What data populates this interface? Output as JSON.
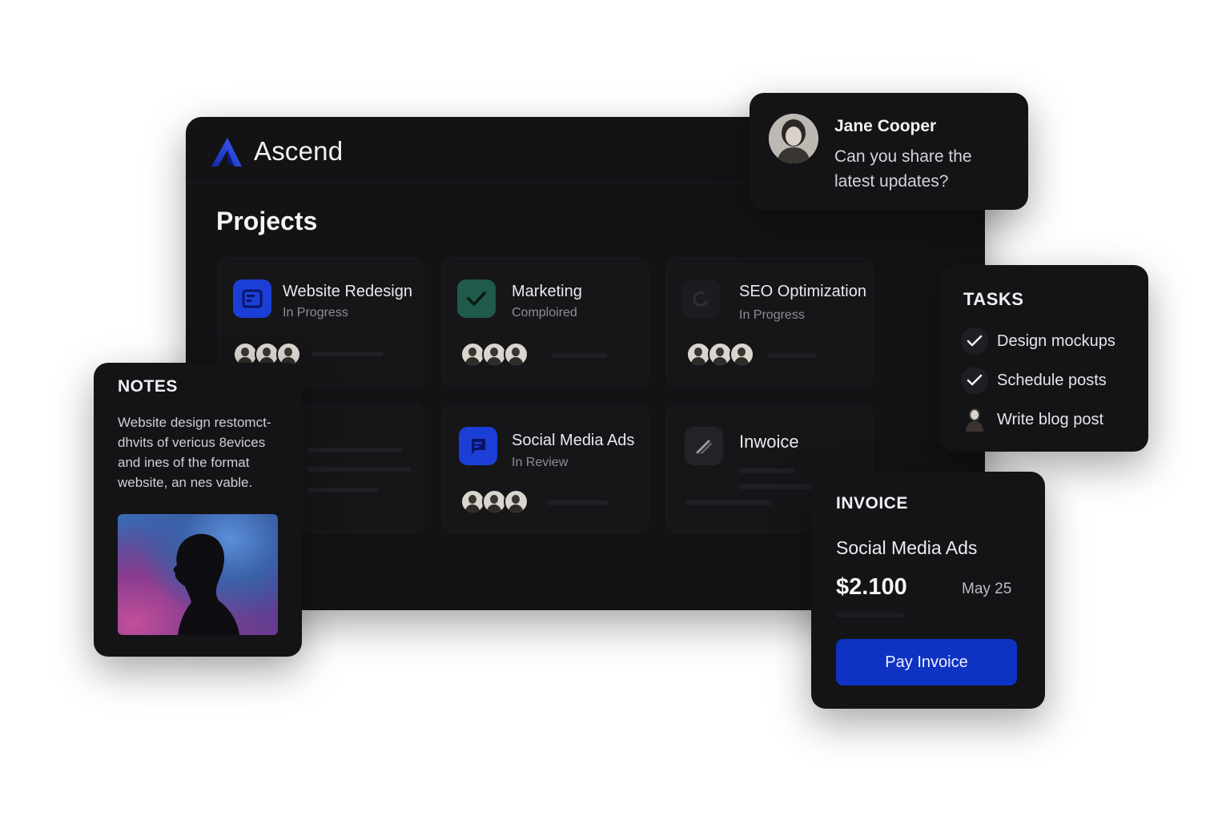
{
  "app": {
    "name": "Ascend",
    "logo_icon": "ascend-logo-icon",
    "accent": "#1f3bd6"
  },
  "page": {
    "title": "Projects"
  },
  "projects": [
    {
      "title": "Website Redesign",
      "status": "In Progress",
      "icon": "layout-icon",
      "color": "#1b3fd6"
    },
    {
      "title": "Marketing",
      "status": "Comploired",
      "icon": "checkmark-icon",
      "color": "#1f5a4a"
    },
    {
      "title": "SEO Optimization",
      "status": "In Progress",
      "icon": "refresh-icon",
      "color": "#1c1c20"
    },
    {
      "title": "Social Media Ads",
      "status": "In Review",
      "icon": "chat-bubble-icon",
      "color": "#1b3fd6"
    },
    {
      "title": "Inwoice",
      "status": "",
      "icon": "pencil-icon",
      "color": "#222227"
    }
  ],
  "chat": {
    "name": "Jane Cooper",
    "message": "Can you share the latest updates?"
  },
  "tasks": {
    "title": "TASKS",
    "items": [
      {
        "label": "Design mockups",
        "icon": "check-icon"
      },
      {
        "label": "Schedule posts",
        "icon": "check-icon"
      },
      {
        "label": "Write blog post",
        "icon": "person-icon"
      }
    ]
  },
  "notes": {
    "title": "NOTES",
    "text": "Website design restomct-dhvits of vericus 8evices and ines of the format website, an nes vable."
  },
  "invoice": {
    "title": "INVOICE",
    "project": "Social Media Ads",
    "amount": "$2.100",
    "date": "May 25",
    "button_label": "Pay Invoice",
    "button_color": "#0e32c2"
  }
}
